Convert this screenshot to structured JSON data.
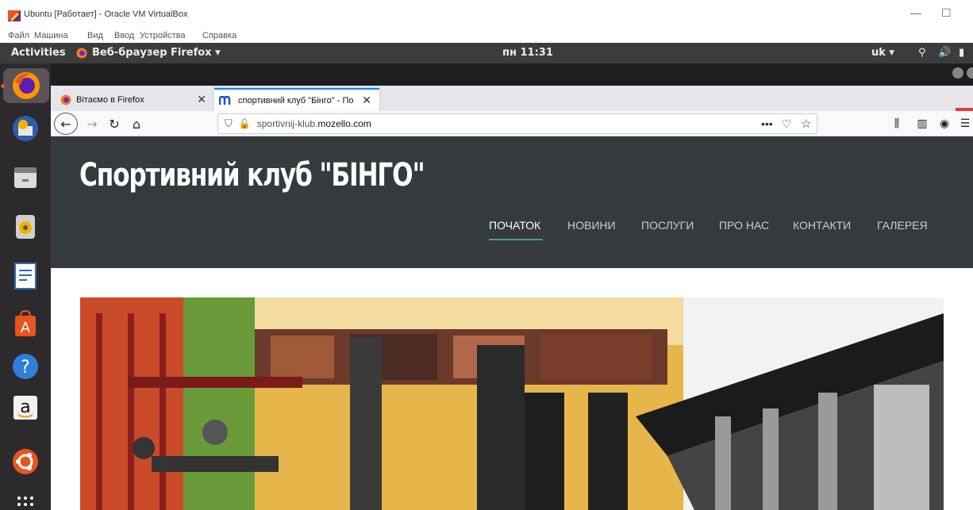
{
  "vbox": {
    "title": "Ubuntu [Работает] - Oracle VM VirtualBox",
    "menu": [
      "Файл",
      "Машина",
      "Вид",
      "Ввод",
      "Устройства",
      "Справка"
    ]
  },
  "topbar": {
    "activities": "Activities",
    "app_name": "Веб-браузер Firefox ▾",
    "clock": "пн 11:31",
    "lang": "uk ▾"
  },
  "browser": {
    "tabs": [
      {
        "label": "Вітаємо в Firefox"
      },
      {
        "label": "спортивний клуб \"Бінго\" - По"
      }
    ],
    "url_prefix": "sportivnij-klub.",
    "url_host": "mozello.com"
  },
  "site": {
    "title": "Спортивний клуб \"БІНГО\"",
    "nav": [
      "ПОЧАТОК",
      "НОВИНИ",
      "ПОСЛУГИ",
      "ПРО НАС",
      "КОНТАКТИ",
      "ГАЛЕРЕЯ"
    ],
    "active_nav": "ПОЧАТОК"
  },
  "colors": {
    "header_bg": "#353a3e",
    "nav_active_underline": "#4ba36a",
    "ubuntu_orange": "#e95420"
  }
}
